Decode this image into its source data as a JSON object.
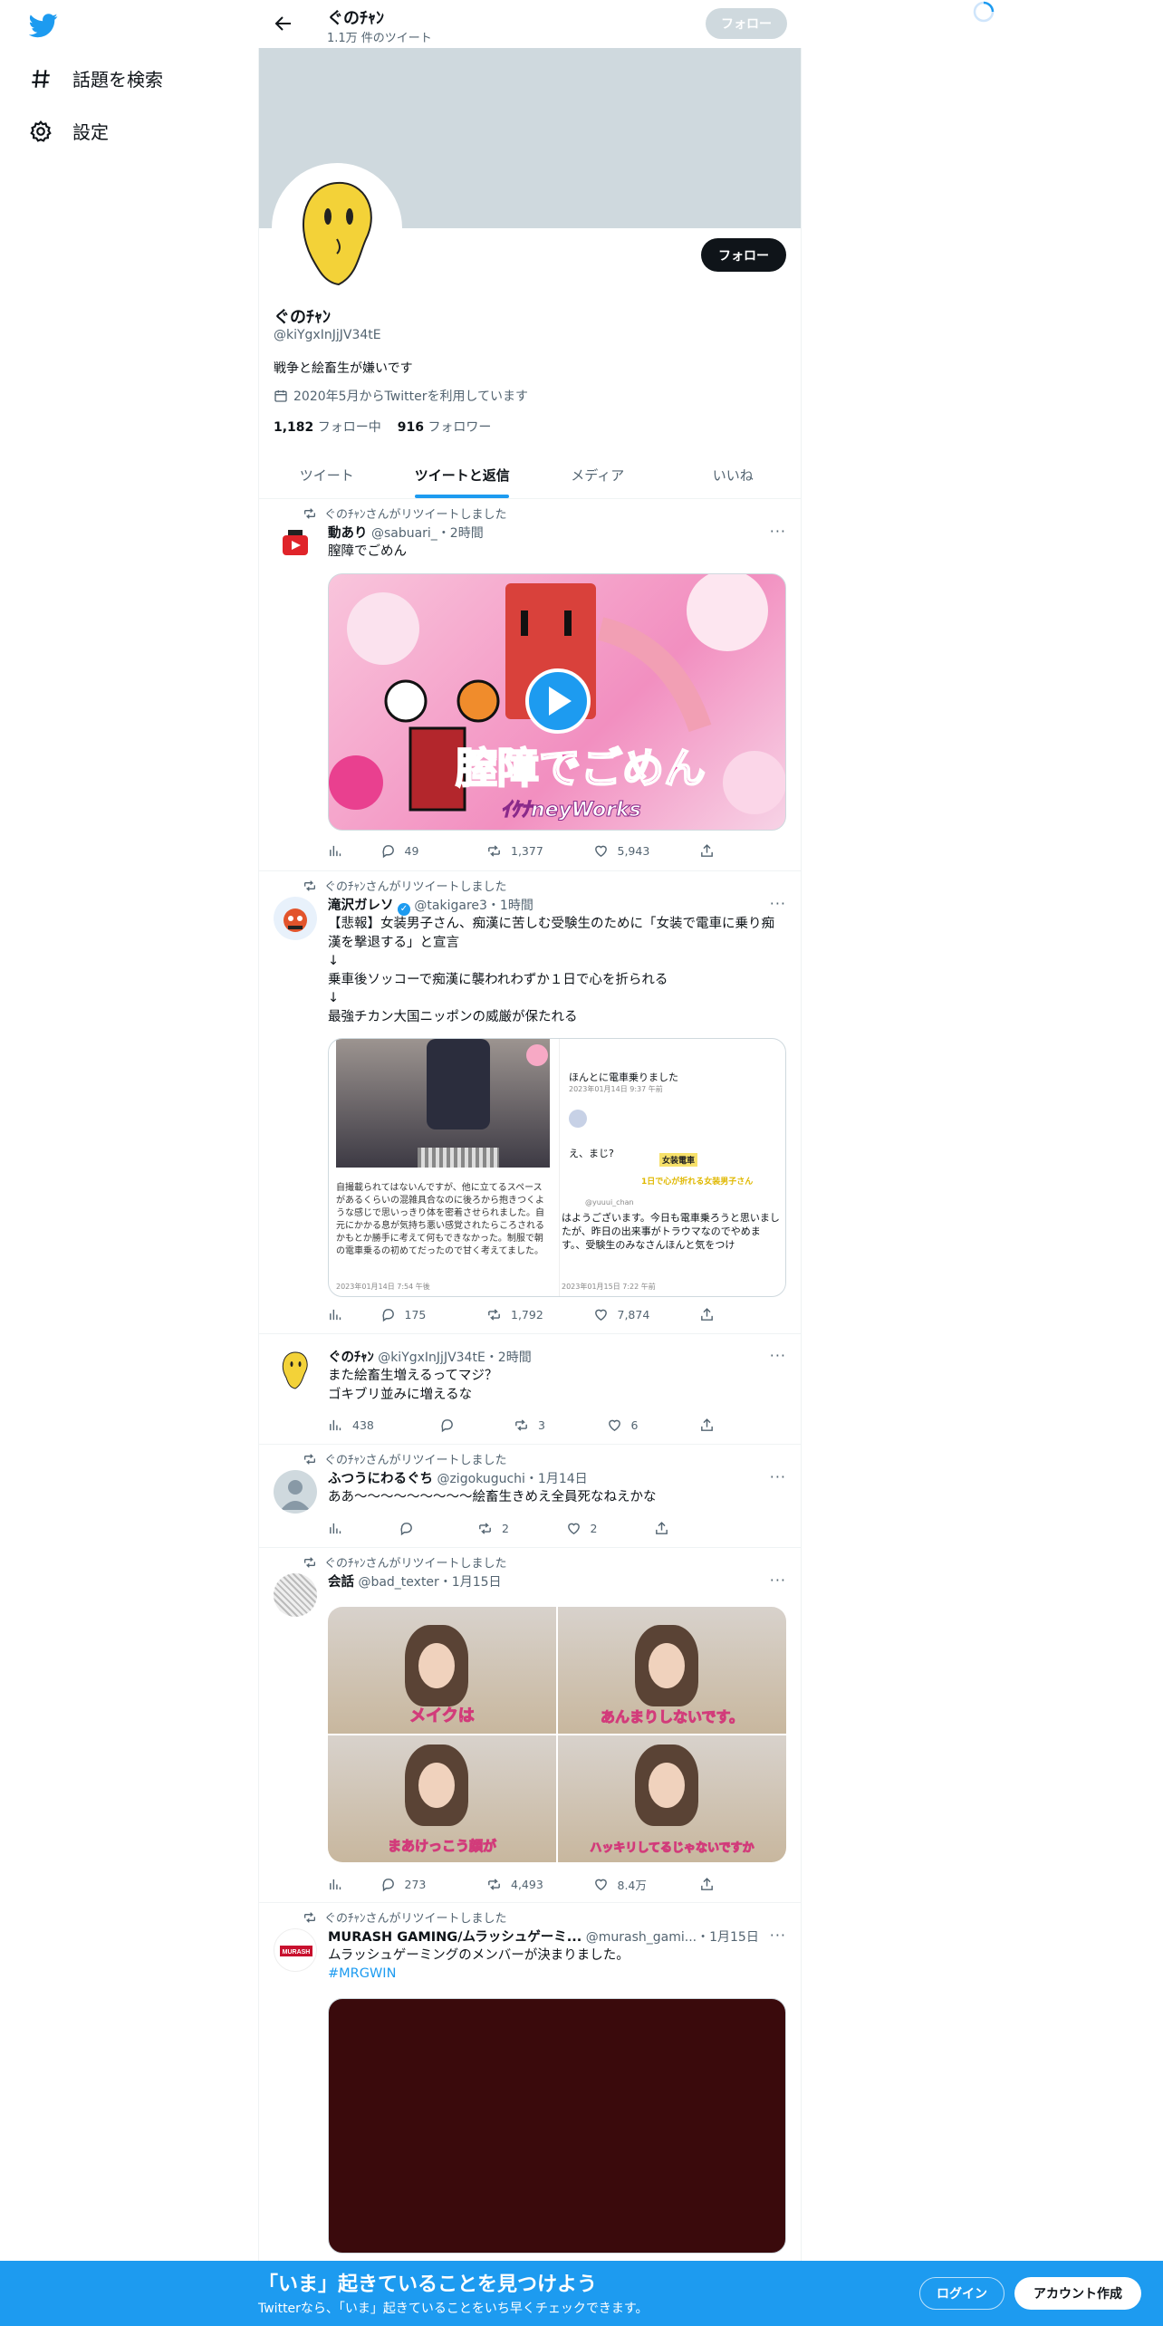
{
  "nav": {
    "explore_label": "話題を検索",
    "settings_label": "設定"
  },
  "header": {
    "name": "ぐのﾁｬﾝ",
    "tweet_count": "1.1万 件のツイート",
    "follow_label": "フォロー"
  },
  "profile": {
    "follow_label": "フォロー",
    "name": "ぐのﾁｬﾝ",
    "handle": "@kiYgxInJjJV34tE",
    "bio": "戦争と絵畜生が嫌いです",
    "joined": "2020年5月からTwitterを利用しています",
    "following_count": "1,182",
    "following_label": "フォロー中",
    "followers_count": "916",
    "followers_label": "フォロワー"
  },
  "tabs": [
    "ツイート",
    "ツイートと返信",
    "メディア",
    "いいね"
  ],
  "tweets": [
    {
      "retweeted_by": "ぐのﾁｬﾝさんがリツイートしました",
      "name": "動あり",
      "handle": "@sabuari_",
      "time": "・2時間",
      "text": "膣障でごめん",
      "media_caption": "膣障でごめん",
      "media_credit": "ｲｹﾅneyWorks",
      "replies": "49",
      "retweets": "1,377",
      "likes": "5,943"
    },
    {
      "retweeted_by": "ぐのﾁｬﾝさんがリツイートしました",
      "name": "滝沢ガレソ",
      "handle": "@takigare3",
      "time": "・1時間",
      "text": "【悲報】女装男子さん、痴漢に苦しむ受験生のために「女装で電車に乗り痴漢を撃退する」と宣言\n↓\n乗車後ソッコーで痴漢に襲われわずか１日で心を折られる\n↓\n最強チカン大国ニッポンの威厳が保たれる",
      "shot1_text": "自撮載られてはないんですが、他に立てるスペースがあるくらいの混雑具合なのに後ろから抱きつくような感じで思いっきり体を密着させられました。自元にかかる息が気持ち悪い感覚されたらころされるかもとか勝手に考えて何もできなかった。制服で朝の電車乗るの初めてだったので甘く考えてました。",
      "shot1_date": "2023年01月14日 7:54 午後",
      "shot2_line1": "ほんとに電車乗りました",
      "shot2_date1": "2023年01月14日 9:37 午前",
      "shot2_line2": "え、まじ?",
      "shot2_text": "はようございます。今日も電車乗ろうと思いましたが、昨日の出来事がトラウマなのでやめます。、受験生のみなさんほんと気をつけ",
      "shot2_date2": "2023年01月15日 7:22 午前",
      "shot2_user": "@yuuui_chan",
      "shot2_badge": "1日で心が折れる女装男子さん",
      "shot2_tag": "女装電車",
      "replies": "175",
      "retweets": "1,792",
      "likes": "7,874"
    },
    {
      "name": "ぐのﾁｬﾝ",
      "handle": "@kiYgxInJjJV34tE",
      "time": "・2時間",
      "text": "また絵畜生増えるってマジ？\nゴキブリ並みに増えるな",
      "views": "438",
      "replies": "",
      "retweets": "3",
      "likes": "6"
    },
    {
      "retweeted_by": "ぐのﾁｬﾝさんがリツイートしました",
      "name": "ふつうにわるぐち",
      "handle": "@zigokuguchi",
      "time": "・1月14日",
      "text": "ああ～～～～～～～～～絵畜生きめえ全員死なねえかな",
      "replies": "",
      "retweets": "2",
      "likes": "2"
    },
    {
      "retweeted_by": "ぐのﾁｬﾝさんがリツイートしました",
      "name": "会話",
      "handle": "@bad_texter",
      "time": "・1月15日",
      "captions": [
        "メイクは",
        "あんまりしないです。",
        "まあけっこう顔が",
        "ハッキリしてるじゃないですか"
      ],
      "replies": "273",
      "retweets": "4,493",
      "likes": "8.4万"
    },
    {
      "retweeted_by": "ぐのﾁｬﾝさんがリツイートしました",
      "name": "MURASH GAMING/ムラッシュゲーミ...",
      "handle": "@murash_gami...",
      "time": "・1月15日",
      "text": "ムラッシュゲーミングのメンバーが決まりました。",
      "hashtag": "#MRGWIN"
    }
  ],
  "bottom": {
    "title": "「いま」起きていることを見つけよう",
    "subtitle": "Twitterなら、「いま」起きていることをいち早くチェックできます。",
    "login_label": "ログイン",
    "signup_label": "アカウント作成"
  },
  "colors": {
    "accent": "#1d9bf0",
    "text": "#0f1419",
    "muted": "#536471"
  }
}
